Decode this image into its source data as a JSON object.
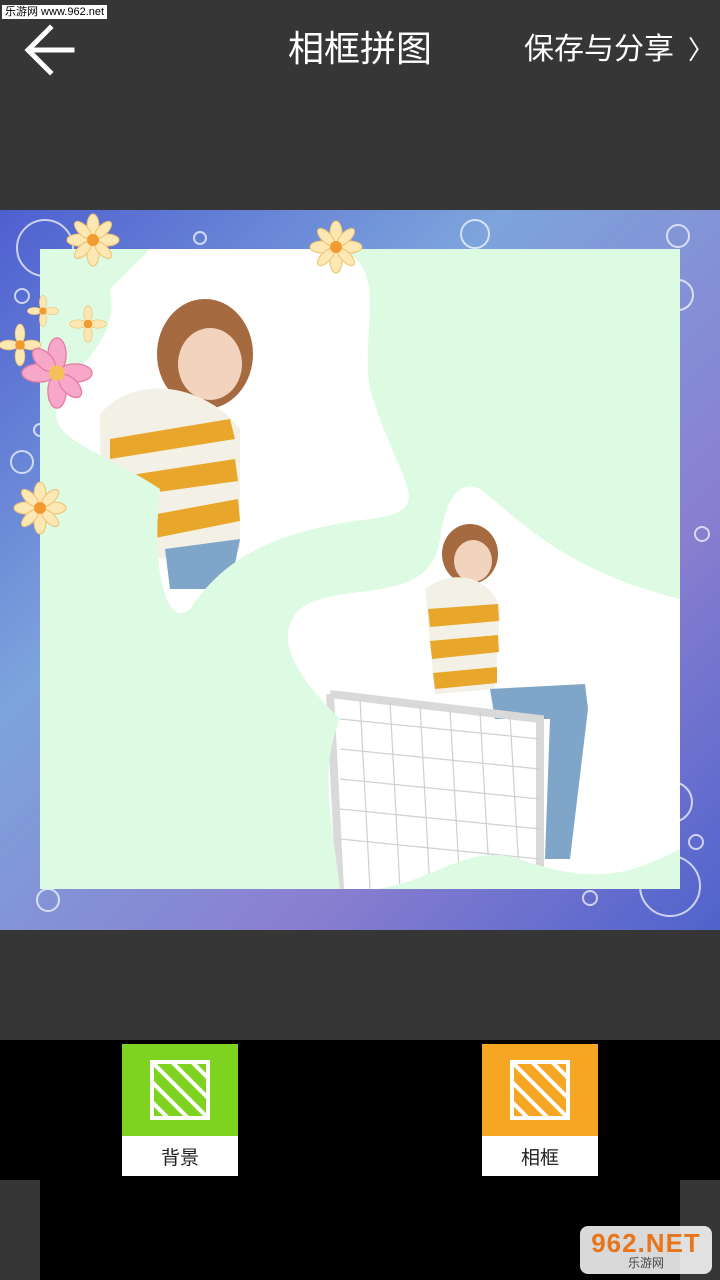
{
  "header": {
    "title": "相框拼图",
    "save_label": "保存与分享",
    "save_chevron": "〉",
    "back_icon": "arrow-left-icon"
  },
  "watermark": {
    "top_text": "乐游网 www.962.net",
    "logo_big": "962.NET",
    "logo_small": "乐游网"
  },
  "canvas": {
    "outer_gradient": [
      "#4e5fd0",
      "#7da4dc",
      "#8a7fd0",
      "#4f63cc"
    ],
    "inner_color": "#ddfbe2",
    "photos": [
      {
        "name": "photo-girl-1",
        "mask": "star"
      },
      {
        "name": "photo-girl-2-soccer-goal",
        "mask": "star"
      }
    ]
  },
  "toolbar": {
    "items": [
      {
        "label": "背景",
        "color": "#7ed321",
        "icon": "stripes-icon"
      },
      {
        "label": "相框",
        "color": "#f5a623",
        "icon": "stripes-icon"
      }
    ]
  }
}
